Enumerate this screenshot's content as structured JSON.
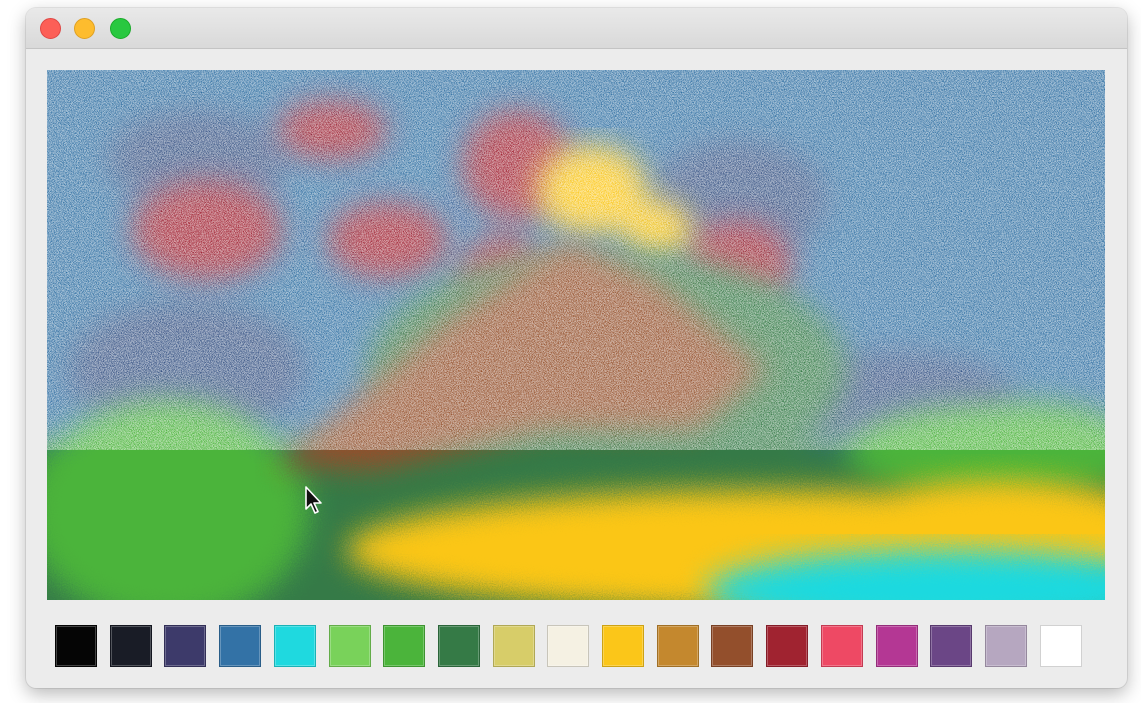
{
  "window": {
    "controls": [
      "close-icon",
      "minimize-icon",
      "zoom-icon"
    ]
  },
  "canvas": {
    "background_color": "#2f6fa2",
    "cursor_icon": "arrow-cursor-icon"
  },
  "palette": {
    "colors": [
      "#050505",
      "#191c26",
      "#3d3a6a",
      "#3372a6",
      "#1fd9df",
      "#79d25a",
      "#4bb43b",
      "#357a46",
      "#d7cd69",
      "#f5f1e3",
      "#fbc619",
      "#c4882e",
      "#934f2c",
      "#a02330",
      "#ee4964",
      "#b43794",
      "#6b4686",
      "#b6a7c0",
      "#ffffff"
    ]
  }
}
